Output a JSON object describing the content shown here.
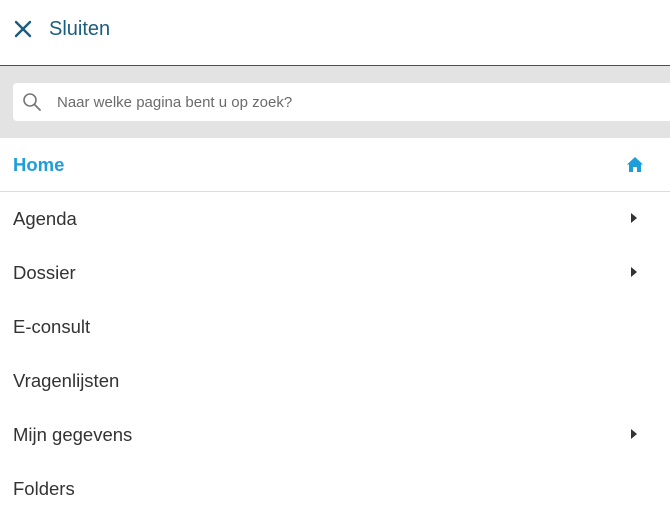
{
  "header": {
    "close_label": "Sluiten",
    "close_icon": "close-icon",
    "accent_color": "#1a5d7e"
  },
  "search": {
    "placeholder": "Naar welke pagina bent u op zoek?",
    "value": "",
    "icon": "search-icon"
  },
  "menu": {
    "active_color": "#1b9ed9",
    "items": [
      {
        "label": "Home",
        "icon": "home-icon",
        "active": true
      },
      {
        "label": "Agenda",
        "icon": "caret-right-icon",
        "has_submenu": true
      },
      {
        "label": "Dossier",
        "icon": "caret-right-icon",
        "has_submenu": true
      },
      {
        "label": "E-consult",
        "has_submenu": false
      },
      {
        "label": "Vragenlijsten",
        "has_submenu": false
      },
      {
        "label": "Mijn gegevens",
        "icon": "caret-right-icon",
        "has_submenu": true
      },
      {
        "label": "Folders",
        "has_submenu": false
      }
    ]
  }
}
